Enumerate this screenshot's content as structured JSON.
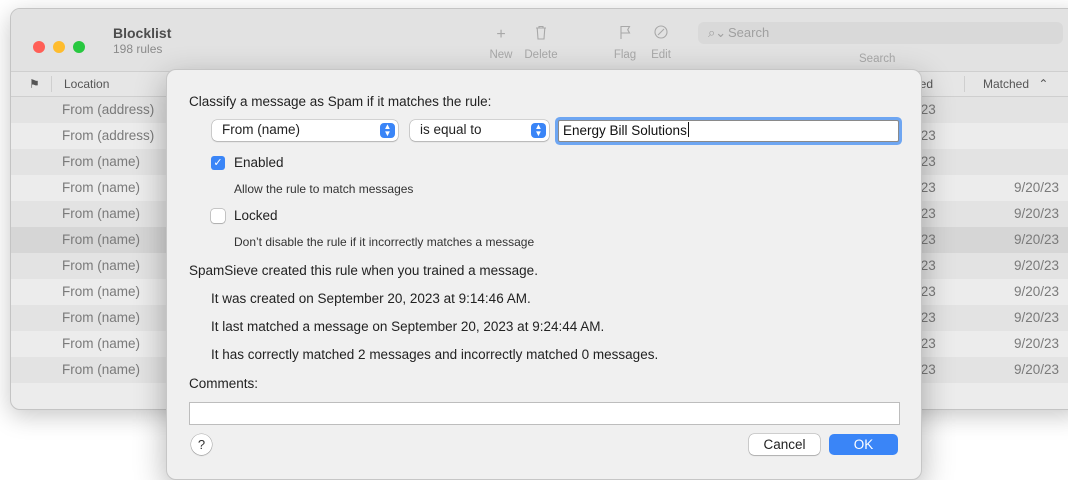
{
  "window": {
    "title": "Blocklist",
    "subtitle": "198 rules",
    "toolbar": {
      "new_label": "New",
      "delete_label": "Delete",
      "flag_label": "Flag",
      "edit_label": "Edit",
      "search_label": "Search",
      "search_placeholder": "Search"
    },
    "table": {
      "columns": [
        "",
        "Location",
        "ied",
        "Matched"
      ],
      "rows": [
        {
          "location": "From (address)",
          "modified": "/23",
          "matched": ""
        },
        {
          "location": "From (address)",
          "modified": "/23",
          "matched": ""
        },
        {
          "location": "From (name)",
          "modified": "/23",
          "matched": ""
        },
        {
          "location": "From (name)",
          "modified": "/23",
          "matched": "9/20/23"
        },
        {
          "location": "From (name)",
          "modified": "/23",
          "matched": "9/20/23"
        },
        {
          "location": "From (name)",
          "modified": "/23",
          "matched": "9/20/23"
        },
        {
          "location": "From (name)",
          "modified": "/23",
          "matched": "9/20/23"
        },
        {
          "location": "From (name)",
          "modified": "/23",
          "matched": "9/20/23"
        },
        {
          "location": "From (name)",
          "modified": "/23",
          "matched": "9/20/23"
        },
        {
          "location": "From (name)",
          "modified": "/23",
          "matched": "9/20/23"
        },
        {
          "location": "From (name)",
          "modified": "/23",
          "matched": "9/20/23"
        }
      ]
    }
  },
  "dialog": {
    "heading": "Classify a message as Spam if it matches the rule:",
    "field_popup": "From (name)",
    "operator_popup": "is equal to",
    "value": "Energy Bill Solutions",
    "enabled_label": "Enabled",
    "enabled_desc": "Allow the rule to match messages",
    "enabled_checked": true,
    "locked_label": "Locked",
    "locked_desc": "Don’t disable the rule if it incorrectly matches a message",
    "locked_checked": false,
    "info_title": "SpamSieve created this rule when you trained a message.",
    "info_created": "It was created on September 20, 2023 at 9:14:46 AM.",
    "info_last": "It last matched a message on September 20, 2023 at 9:24:44 AM.",
    "info_count": "It has correctly matched 2 messages and incorrectly matched 0 messages.",
    "comments_label": "Comments:",
    "comments_value": "",
    "help_label": "?",
    "cancel_label": "Cancel",
    "ok_label": "OK"
  },
  "colors": {
    "accent": "#3a85f7",
    "traffic_close": "#ff5f57",
    "traffic_min": "#febc2e",
    "traffic_max": "#28c840"
  }
}
